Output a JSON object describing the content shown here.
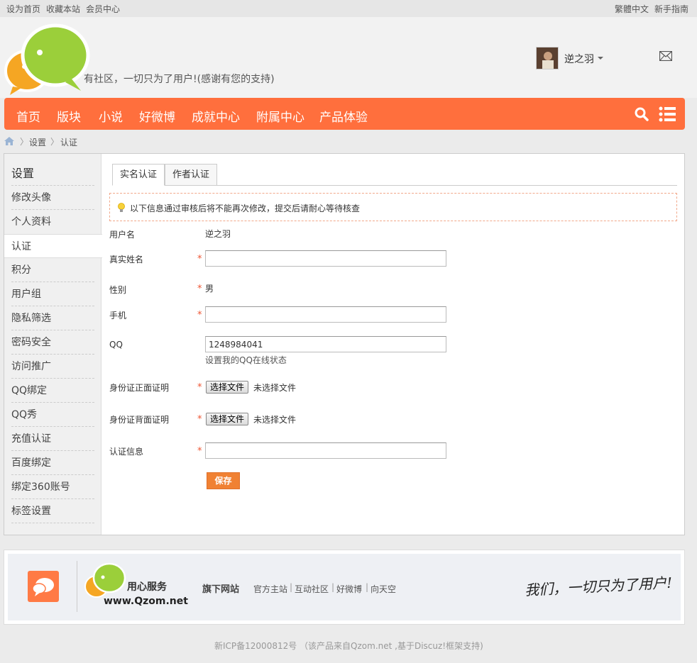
{
  "topbar": {
    "links_left": [
      "设为首页",
      "收藏本站",
      "会员中心"
    ],
    "links_right": [
      "繁體中文",
      "新手指南"
    ]
  },
  "header": {
    "slogan": "有社区，一切只为了用户!(感谢有您的支持)",
    "username": "逆之羽"
  },
  "nav": {
    "items": [
      "首页",
      "版块",
      "小说",
      "好微博",
      "成就中心",
      "附属中心",
      "产品体验"
    ]
  },
  "breadcrumb": [
    "设置",
    "认证"
  ],
  "sidebar": {
    "title": "设置",
    "items": [
      "修改头像",
      "个人资料",
      "认证",
      "积分",
      "用户组",
      "隐私筛选",
      "密码安全",
      "访问推广",
      "QQ绑定",
      "QQ秀",
      "充值认证",
      "百度绑定",
      "绑定360账号",
      "标签设置"
    ],
    "active_index": 2
  },
  "tabs": [
    "实名认证",
    "作者认证"
  ],
  "notice": "以下信息通过审核后将不能再次修改，提交后请耐心等待核查",
  "form": {
    "username_label": "用户名",
    "username_value": "逆之羽",
    "realname_label": "真实姓名",
    "realname_value": "",
    "gender_label": "性别",
    "gender_value": "男",
    "phone_label": "手机",
    "phone_value": "",
    "qq_label": "QQ",
    "qq_value": "1248984041",
    "qq_hint": "设置我的QQ在线状态",
    "id_front_label": "身份证正面证明",
    "id_back_label": "身份证背面证明",
    "file_button": "选择文件",
    "file_none": "未选择文件",
    "auth_info_label": "认证信息",
    "auth_info_value": "",
    "required_mark": "*",
    "save_label": "保存"
  },
  "footer": {
    "service": "用心服务",
    "url": "www.Qzom.net",
    "sites_title": "旗下网站",
    "sites": [
      "官方主站",
      "互动社区",
      "好微博",
      "向天空"
    ],
    "motto": "我们，一切只为了用户!",
    "copyright": "新ICP备12000812号 （该产品来自Qzom.net ,基于Discuz!框架支持)"
  },
  "colors": {
    "nav": "#ff6f3d",
    "save_button": "#f08133",
    "required": "#e53"
  }
}
